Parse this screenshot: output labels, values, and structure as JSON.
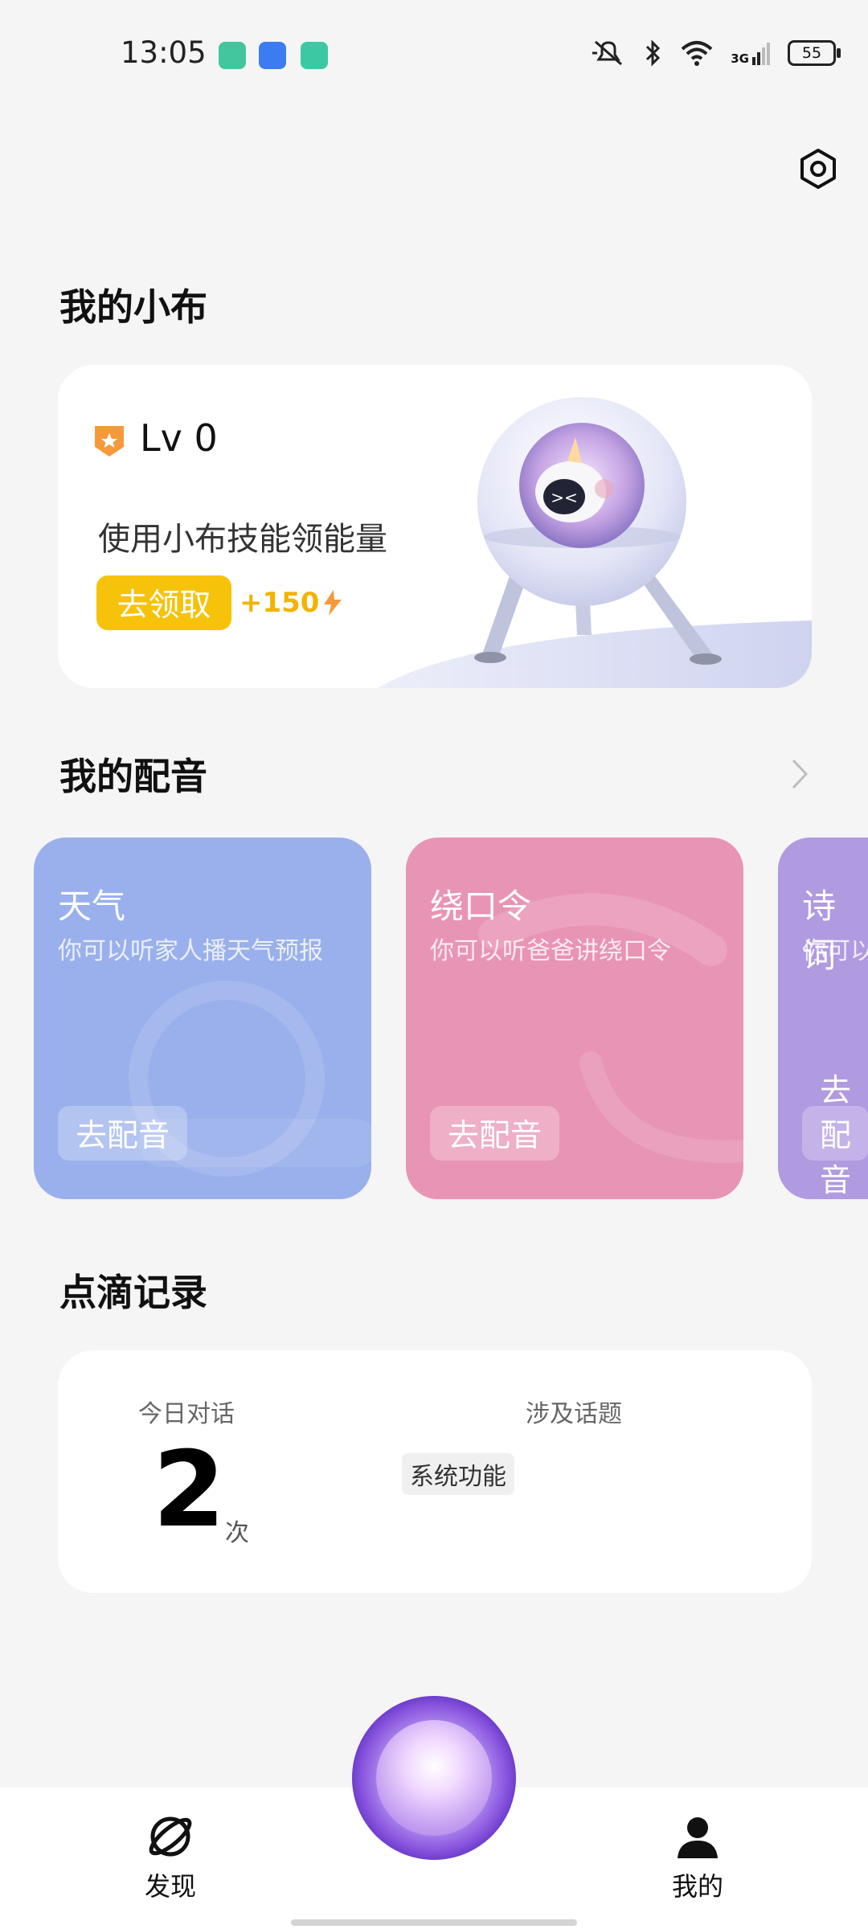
{
  "status_bar": {
    "time": "13:05",
    "network": "3G",
    "battery": "55",
    "app_colors": [
      "#43c59e",
      "#3b7cf0",
      "#3dc8a4"
    ],
    "icons": [
      "mute-icon",
      "bluetooth-icon",
      "wifi-icon",
      "signal-icon",
      "battery-icon"
    ]
  },
  "header": {
    "settings_icon": "gear-icon"
  },
  "my_xiaobu": {
    "title": "我的小布",
    "level": "Lv 0",
    "description": "使用小布技能领能量",
    "claim_button": "去领取",
    "bonus": "+150"
  },
  "dubbing": {
    "title": "我的配音",
    "cards": [
      {
        "title": "天气",
        "subtitle": "你可以听家人播天气预报",
        "button": "去配音",
        "color": "#9ab0ec"
      },
      {
        "title": "绕口令",
        "subtitle": "你可以听爸爸讲绕口令",
        "button": "去配音",
        "color": "#e894b5"
      },
      {
        "title": "诗词",
        "subtitle": "你可以",
        "button": "去配音",
        "color": "#b09ae0"
      }
    ]
  },
  "record": {
    "title": "点滴记录",
    "today_label": "今日对话",
    "today_count": "2",
    "today_unit": "次",
    "topics_label": "涉及话题",
    "topics": [
      "系统功能"
    ]
  },
  "nav": {
    "discover": "发现",
    "mine": "我的"
  }
}
